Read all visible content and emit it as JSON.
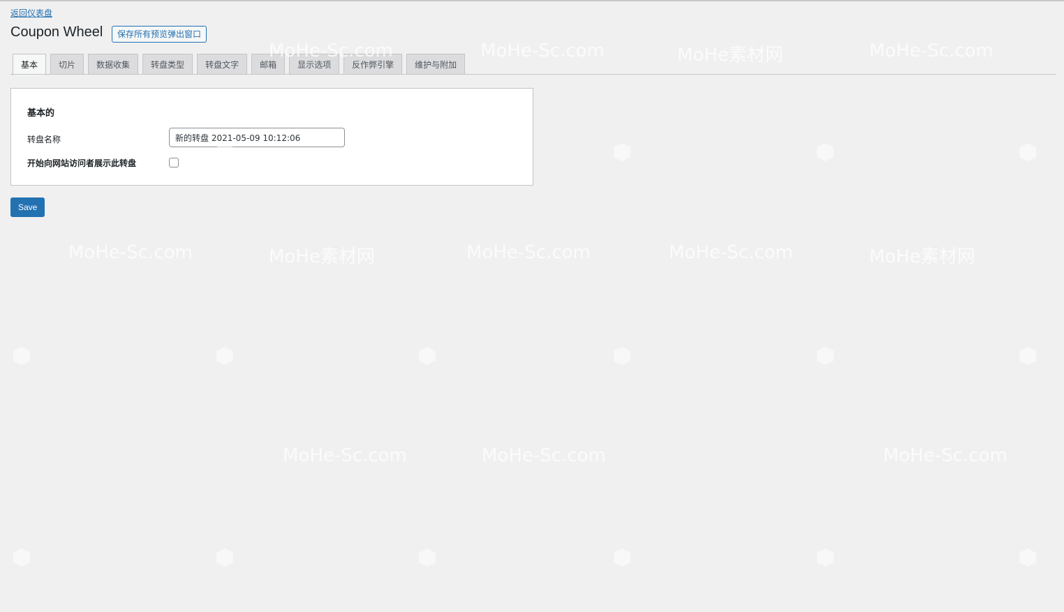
{
  "nav": {
    "back_label": "返回仪表盘"
  },
  "header": {
    "title": "Coupon Wheel",
    "save_all_label": "保存所有预览弹出窗口"
  },
  "tabs": [
    {
      "label": "基本",
      "active": true
    },
    {
      "label": "切片",
      "active": false
    },
    {
      "label": "数据收集",
      "active": false
    },
    {
      "label": "转盘类型",
      "active": false
    },
    {
      "label": "转盘文字",
      "active": false
    },
    {
      "label": "邮箱",
      "active": false
    },
    {
      "label": "显示选项",
      "active": false
    },
    {
      "label": "反作弊引擎",
      "active": false
    },
    {
      "label": "维护与附加",
      "active": false
    }
  ],
  "panel": {
    "title": "基本的",
    "wheel_name_label": "转盘名称",
    "wheel_name_value": "新的转盘 2021-05-09 10:12:06",
    "show_label": "开始向网站访问者展示此转盘",
    "show_checked": false
  },
  "footer": {
    "save_label": "Save"
  },
  "watermark": {
    "text": "MoHe-Sc.com",
    "text_cn": "MoHe素材网"
  },
  "colors": {
    "accent": "#2271b1",
    "background": "#f0f0f1",
    "panel": "#ffffff",
    "tab_inactive": "#dcdcde"
  }
}
